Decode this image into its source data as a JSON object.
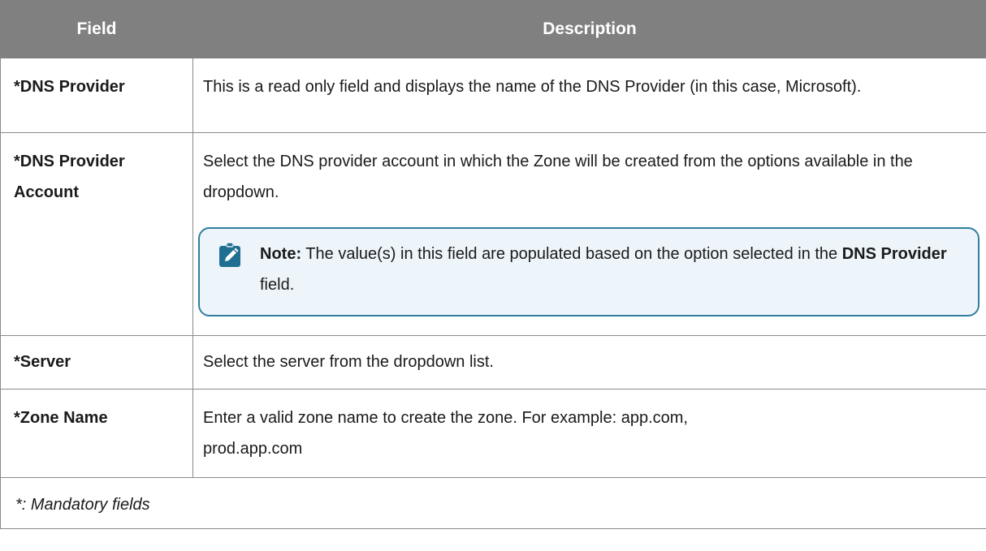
{
  "table": {
    "headers": {
      "field": "Field",
      "description": "Description"
    },
    "rows": [
      {
        "field": "*DNS Provider",
        "description": "This is a read only field and displays the name of the DNS Provider (in this case, Microsoft)."
      },
      {
        "field_line1": "*DNS Provider",
        "field_line2": "Account",
        "description": "Select the DNS provider account in which the Zone will be created from the options available in the dropdown.",
        "note": {
          "icon": "pencil-note-icon",
          "label": "Note:",
          "text_before": " The value(s) in this field are populated based on the option selected in the ",
          "emphasis": "DNS Provider",
          "text_after": " field."
        }
      },
      {
        "field": "*Server",
        "description": "Select the server from the dropdown list."
      },
      {
        "field": "*Zone Name",
        "description_line1": "Enter a valid zone name to create the zone. For example: app.com,",
        "description_line2": "prod.app.com"
      }
    ],
    "footnote": "*: Mandatory fields"
  },
  "colors": {
    "header_bg": "#808080",
    "border": "#8a8a8a",
    "note_border": "#2f7ea0",
    "note_bg": "#eef5fa",
    "note_icon": "#1f6f92"
  }
}
